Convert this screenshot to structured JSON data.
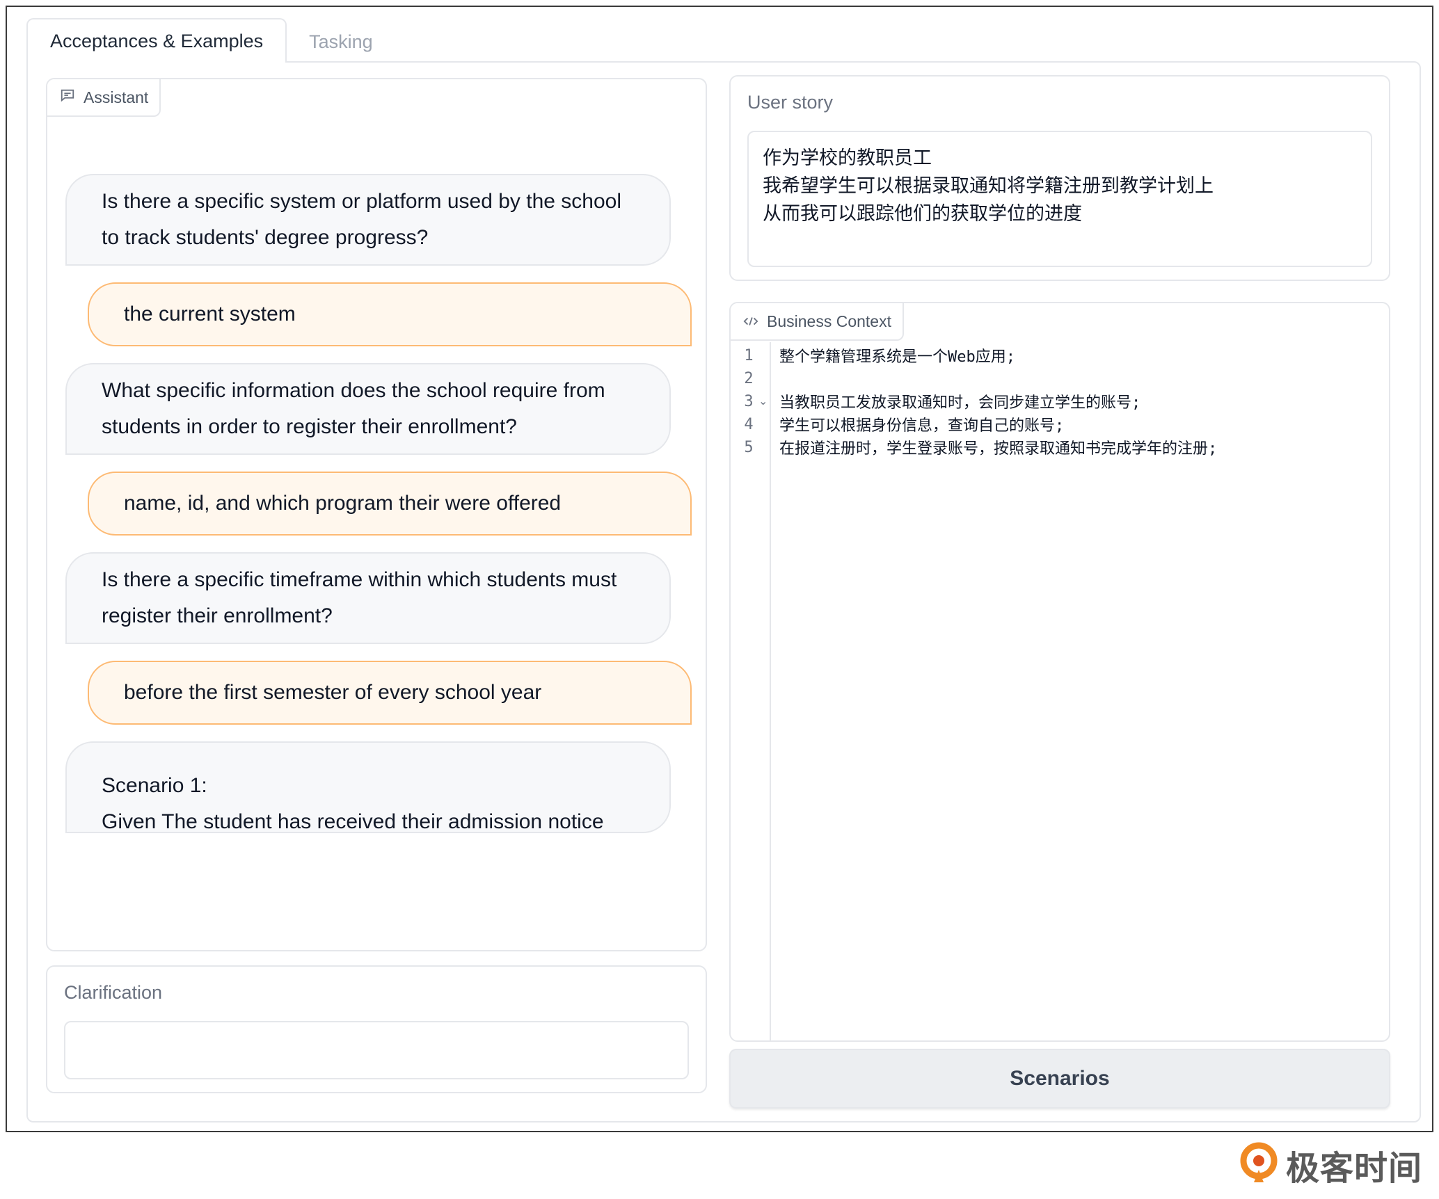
{
  "tabs": {
    "active": "Acceptances & Examples",
    "inactive": "Tasking"
  },
  "assistant": {
    "label": "Assistant",
    "messages": [
      {
        "role": "bot",
        "lines": [
          "Is there a specific system or platform used by the school",
          "to track students' degree progress?"
        ]
      },
      {
        "role": "user",
        "lines": [
          "the current system"
        ]
      },
      {
        "role": "bot",
        "lines": [
          "What specific information does the school require from",
          "students in order to register their enrollment?"
        ]
      },
      {
        "role": "user",
        "lines": [
          "name, id, and which program their were offered"
        ]
      },
      {
        "role": "bot",
        "lines": [
          "Is there a specific timeframe within which students must",
          "register their enrollment?"
        ]
      },
      {
        "role": "user",
        "lines": [
          "before the first semester of every school year"
        ]
      },
      {
        "role": "bot",
        "lines": [
          "Scenario 1:",
          "Given The student has received their admission notice"
        ]
      }
    ]
  },
  "clarification": {
    "label": "Clarification",
    "value": ""
  },
  "user_story": {
    "label": "User story",
    "text": "作为学校的教职员工\n我希望学生可以根据录取通知将学籍注册到教学计划上\n从而我可以跟踪他们的获取学位的进度"
  },
  "business_context": {
    "label": "Business Context",
    "lines": [
      {
        "num": "1",
        "text": "整个学籍管理系统是一个Web应用;",
        "fold": ""
      },
      {
        "num": "2",
        "text": "",
        "fold": ""
      },
      {
        "num": "3",
        "text": "当教职员工发放录取通知时，会同步建立学生的账号;",
        "fold": "⌄"
      },
      {
        "num": "4",
        "text": "学生可以根据身份信息，查询自己的账号;",
        "fold": ""
      },
      {
        "num": "5",
        "text": "在报道注册时，学生登录账号，按照录取通知书完成学年的注册;",
        "fold": ""
      }
    ]
  },
  "scenarios_button": "Scenarios",
  "watermark": "极客时间",
  "colors": {
    "user_bubble_bg": "#fff7ed",
    "user_bubble_border": "#fdba74",
    "bot_bubble_bg": "#f7f8fa",
    "watermark_orange": "#f08a24"
  }
}
